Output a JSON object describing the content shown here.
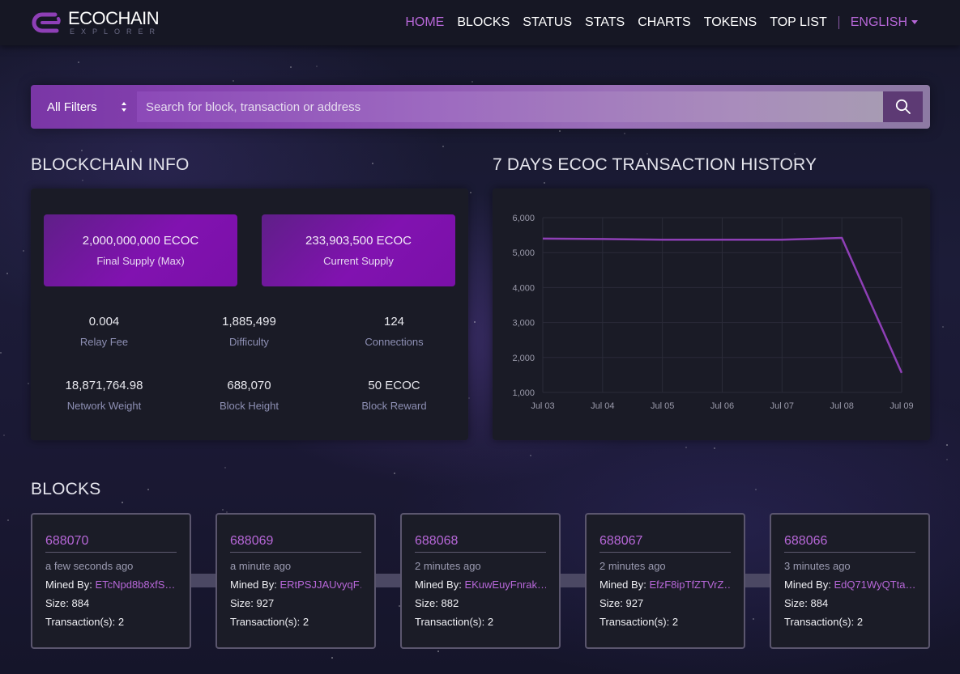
{
  "nav": {
    "logo_main": "ECOCHAIN",
    "logo_sub": "EXPLORER",
    "links": [
      "HOME",
      "BLOCKS",
      "STATUS",
      "STATS",
      "CHARTS",
      "TOKENS",
      "TOP LIST"
    ],
    "language": "ENGLISH",
    "active_color": "#b767d8"
  },
  "search": {
    "filter_label": "All Filters",
    "placeholder": "Search for block, transaction or address",
    "button_icon": "search-icon"
  },
  "blockchain_info": {
    "title": "BLOCKCHAIN INFO",
    "final_supply": {
      "value": "2,000,000,000 ECOC",
      "label": "Final Supply (Max)"
    },
    "current_supply": {
      "value": "233,903,500 ECOC",
      "label": "Current Supply"
    },
    "stats": [
      {
        "value": "0.004",
        "label": "Relay Fee"
      },
      {
        "value": "1,885,499",
        "label": "Difficulty"
      },
      {
        "value": "124",
        "label": "Connections"
      },
      {
        "value": "18,871,764.98",
        "label": "Network Weight"
      },
      {
        "value": "688,070",
        "label": "Block Height"
      },
      {
        "value": "50 ECOC",
        "label": "Block Reward"
      }
    ]
  },
  "history": {
    "title": "7 DAYS ECOC TRANSACTION HISTORY"
  },
  "chart_data": {
    "type": "line",
    "x": [
      "Jul 03",
      "Jul 04",
      "Jul 05",
      "Jul 06",
      "Jul 07",
      "Jul 08",
      "Jul 09"
    ],
    "series": [
      {
        "values": [
          5400,
          5390,
          5370,
          5370,
          5370,
          5420,
          1560
        ],
        "color": "#8e3fb6"
      }
    ],
    "ylim": [
      1000,
      6000
    ],
    "yticks": [
      "1,000",
      "2,000",
      "3,000",
      "4,000",
      "5,000",
      "6,000"
    ],
    "grid": true,
    "xlabel": "",
    "ylabel": ""
  },
  "blocks": {
    "title": "BLOCKS",
    "mined_by_label": "Mined By:",
    "size_label": "Size:",
    "tx_label": "Transaction(s):",
    "items": [
      {
        "height": "688070",
        "time": "a few seconds ago",
        "miner": "ETcNpd8b8xfS…",
        "size": "884",
        "tx": "2"
      },
      {
        "height": "688069",
        "time": "a minute ago",
        "miner": "ERtPSJJAUvyqF…",
        "size": "927",
        "tx": "2"
      },
      {
        "height": "688068",
        "time": "2 minutes ago",
        "miner": "EKuwEuyFnrak…",
        "size": "882",
        "tx": "2"
      },
      {
        "height": "688067",
        "time": "2 minutes ago",
        "miner": "EfzF8ipTfZTVrZ…",
        "size": "927",
        "tx": "2"
      },
      {
        "height": "688066",
        "time": "3 minutes ago",
        "miner": "EdQ71WyQTta…",
        "size": "884",
        "tx": "2"
      }
    ]
  }
}
